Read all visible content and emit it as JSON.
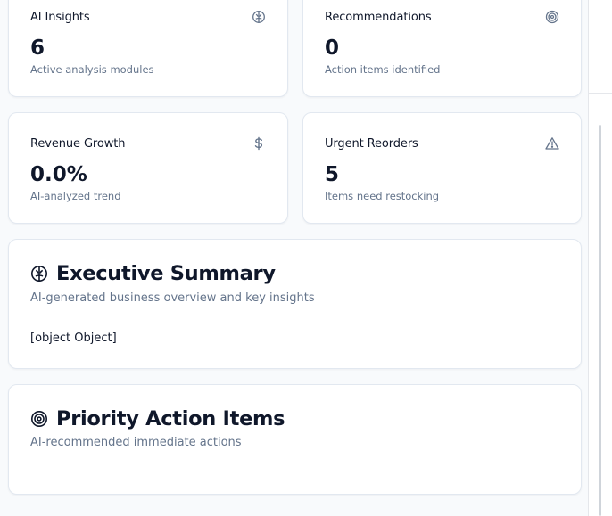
{
  "stats": [
    {
      "title": "AI Insights",
      "value": "6",
      "desc": "Active analysis modules",
      "icon": "brain-icon"
    },
    {
      "title": "Recommendations",
      "value": "0",
      "desc": "Action items identified",
      "icon": "target-icon"
    },
    {
      "title": "Revenue Growth",
      "value": "0.0%",
      "desc": "AI-analyzed trend",
      "icon": "dollar-icon"
    },
    {
      "title": "Urgent Reorders",
      "value": "5",
      "desc": "Items need restocking",
      "icon": "alert-triangle-icon"
    }
  ],
  "executive_summary": {
    "title": "Executive Summary",
    "subtitle": "AI-generated business overview and key insights",
    "content": "[object Object]",
    "icon": "brain-icon"
  },
  "priority_actions": {
    "title": "Priority Action Items",
    "subtitle": "AI-recommended immediate actions",
    "icon": "target-icon"
  },
  "colors": {
    "background": "#f8fafc",
    "card": "#ffffff",
    "border": "#e2e8f0",
    "text_primary": "#0f172a",
    "text_muted": "#64748b"
  }
}
